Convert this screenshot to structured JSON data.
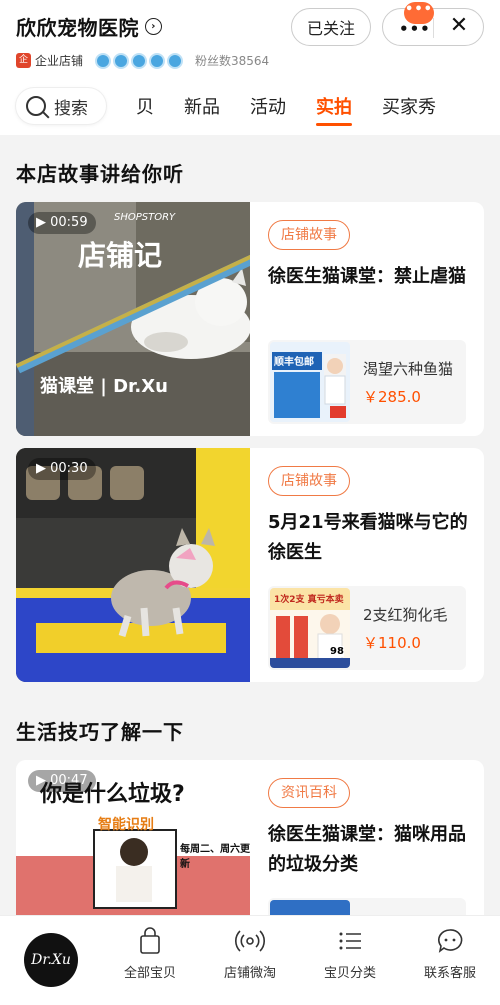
{
  "header": {
    "shop_name": "欣欣宠物医院",
    "follow_label": "已关注",
    "more_label": "•••",
    "close_label": "✕",
    "bubble_label": "•••",
    "enterprise_label": "企业店铺",
    "enterprise_badge": "企",
    "fans_label": "粉丝数38564",
    "rating_diamonds": 5
  },
  "tabs": {
    "search_label": "搜索",
    "items": [
      "贝",
      "新品",
      "活动",
      "实拍",
      "买家秀"
    ],
    "active": "实拍"
  },
  "sections": [
    {
      "title": "本店故事讲给你听",
      "cards": [
        {
          "duration": "▶ 00:59",
          "thumb_text": {
            "line1": "店铺记",
            "line2": "猫课堂 | Dr.Xu",
            "small": "SHOPSTORY"
          },
          "tag": "店铺故事",
          "title": "徐医生猫课堂：禁止虐猫",
          "product": {
            "name": "渴望六种鱼猫",
            "price": "￥285.0",
            "img_text": "顺丰包邮"
          }
        },
        {
          "duration": "▶ 00:30",
          "thumb_text": {},
          "tag": "店铺故事",
          "title": "5月21号来看猫咪与它的徐医生",
          "product": {
            "name": "2支红狗化毛",
            "price": "￥110.0",
            "img_text": "1次2支 真亏本卖",
            "img_badge": "98"
          }
        }
      ]
    },
    {
      "title": "生活技巧了解一下",
      "cards": [
        {
          "duration": "▶ 00:47",
          "thumb_text": {
            "line1": "你是什么垃圾?",
            "line2": "智能识别",
            "small": "每周二、周六更新"
          },
          "tag": "资讯百科",
          "title": "徐医生猫课堂：猫咪用品的垃圾分类",
          "product": {
            "name": "",
            "price": ""
          }
        }
      ]
    }
  ],
  "tabbar": {
    "logo_text": "Dr.Xu",
    "items": [
      "全部宝贝",
      "店铺微淘",
      "宝贝分类",
      "联系客服"
    ]
  },
  "colors": {
    "accent": "#ff5000",
    "tag": "#f07a45",
    "background": "#f3f3f3"
  }
}
